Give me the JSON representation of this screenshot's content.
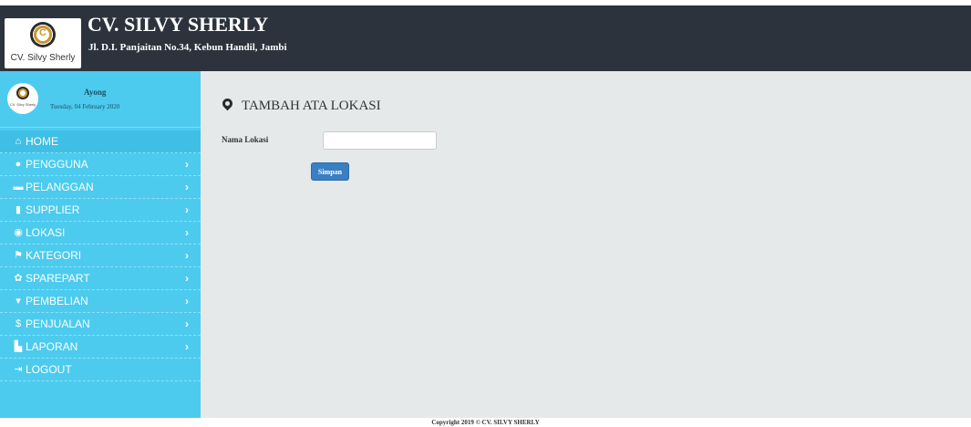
{
  "header": {
    "logo_text": "CV. Silvy Sherly",
    "logo_letter": "C",
    "company_name": "CV. SILVY SHERLY",
    "address": "Jl. D.I. Panjaitan No.34, Kebun Handil, Jambi"
  },
  "sidebar": {
    "avatar_text": "CV. Silvy Sherly",
    "user_name": "Ayong",
    "date": "Tuesday, 04 February 2020",
    "items": [
      {
        "label": "HOME",
        "icon": "home-icon",
        "glyph": "⌂",
        "chevron": ""
      },
      {
        "label": "PENGGUNA",
        "icon": "user-icon",
        "glyph": "●",
        "chevron": "›"
      },
      {
        "label": "PELANGGAN",
        "icon": "briefcase-icon",
        "glyph": "▬",
        "chevron": "›"
      },
      {
        "label": "SUPPLIER",
        "icon": "bookmark-icon",
        "glyph": "▮",
        "chevron": "›"
      },
      {
        "label": "LOKASI",
        "icon": "map-marker-icon",
        "glyph": "◉",
        "chevron": "›"
      },
      {
        "label": "KATEGORI",
        "icon": "flag-icon",
        "glyph": "⚑",
        "chevron": "›"
      },
      {
        "label": "SPAREPART",
        "icon": "cog-icon",
        "glyph": "✿",
        "chevron": "›"
      },
      {
        "label": "PEMBELIAN",
        "icon": "shopping-cart-icon",
        "glyph": "▾",
        "chevron": "›"
      },
      {
        "label": "PENJUALAN",
        "icon": "dollar-icon",
        "glyph": "$",
        "chevron": "›"
      },
      {
        "label": "LAPORAN",
        "icon": "file-icon",
        "glyph": "▙",
        "chevron": "›"
      },
      {
        "label": "LOGOUT",
        "icon": "logout-icon",
        "glyph": "⇥",
        "chevron": ""
      }
    ]
  },
  "main": {
    "title": "TAMBAH ATA LOKASI",
    "field_label": "Nama Lokasi",
    "field_value": "",
    "save_label": "Simpan"
  },
  "footer": {
    "copyright": "Copyright 2019 © CV. SILVY SHERLY"
  },
  "colors": {
    "header_bg": "#2c333d",
    "sidebar_bg": "#4ccbef",
    "content_bg": "#e5e9ea",
    "button_bg": "#3a7fc4"
  }
}
